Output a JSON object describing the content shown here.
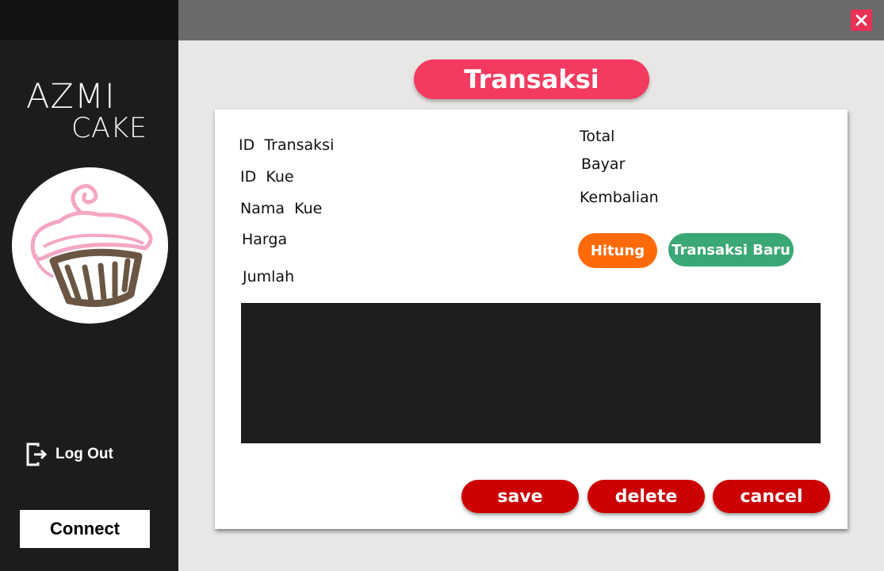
{
  "sidebar": {
    "brand_line1": "AZMI",
    "brand_line2": "CAKE",
    "logout_label": "Log Out",
    "connect_label": "Connect"
  },
  "window": {
    "close_icon": "close-icon",
    "accent_color": "#e83155"
  },
  "page": {
    "title": "Transaksi"
  },
  "form": {
    "left_labels": {
      "id_transaksi": "ID  Transaksi",
      "id_kue": "ID  Kue",
      "nama_kue": "Nama  Kue",
      "harga": "Harga",
      "jumlah": "Jumlah"
    },
    "right_labels": {
      "total": "Total",
      "bayar": "Bayar",
      "kembalian": "Kembalian"
    },
    "buttons": {
      "hitung": "Hitung",
      "transaksi_baru": "Transaksi Baru"
    }
  },
  "actions": {
    "save": "save",
    "delete": "delete",
    "cancel": "cancel"
  },
  "colors": {
    "title_pill": "#f43a60",
    "hitung": "#ff6a08",
    "transaksi_baru": "#3aa874",
    "action_buttons": "#cc0000",
    "sidebar": "#1c1c1c"
  }
}
